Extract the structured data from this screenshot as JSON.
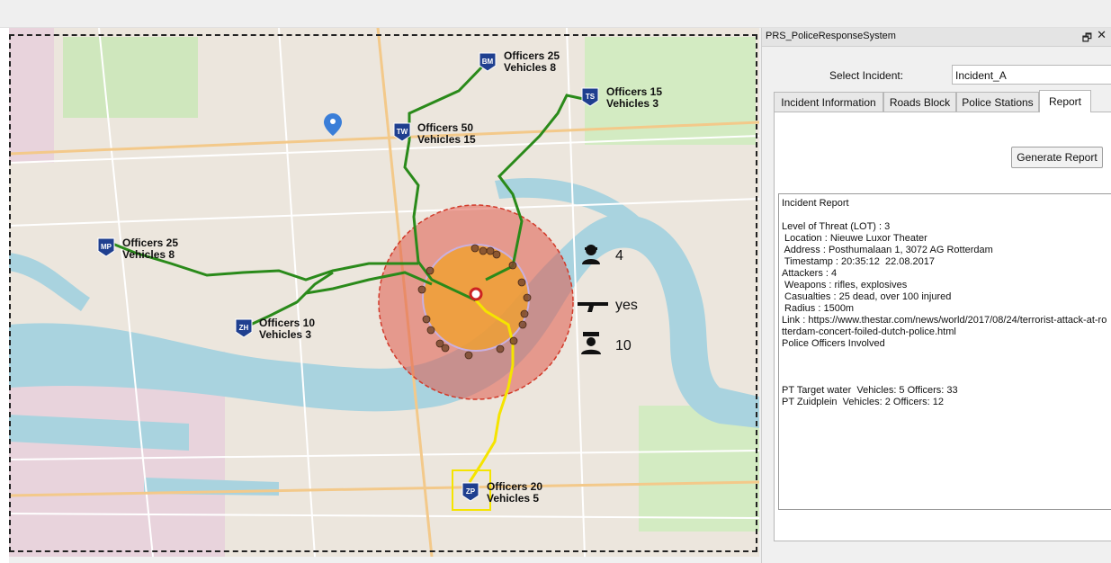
{
  "window": {
    "title": "PRS_PoliceResponseSystem",
    "float_icon": "float-window-icon",
    "close_icon": "close-icon"
  },
  "select": {
    "label": "Select Incident:",
    "value": "Incident_A"
  },
  "tabs": [
    {
      "label": "Incident Information",
      "active": false
    },
    {
      "label": "Roads Block",
      "active": false
    },
    {
      "label": "Police Stations",
      "active": false
    },
    {
      "label": "Report",
      "active": true
    }
  ],
  "generate_button": "Generate Report",
  "report": {
    "heading": "Incident Report",
    "lines": [
      "Level of Threat (LOT) : 3",
      " Location : Nieuwe Luxor Theater",
      " Address : Posthumalaan 1, 3072 AG Rotterdam",
      " Timestamp : 20:35:12  22.08.2017",
      "Attackers : 4",
      " Weapons : rifles, explosives",
      " Casualties : 25 dead, over 100 injured",
      " Radius : 1500m"
    ],
    "link": " Link : https://www.thestar.com/news/world/2017/08/24/terrorist-attack-at-rotterdam-concert-foiled-dutch-police.html",
    "officers_heading": "Police Officers Involved",
    "assignments": [
      "PT Target water  Vehicles: 5 Officers: 33",
      "PT Zuidplein  Vehicles: 2 Officers: 12"
    ]
  },
  "map": {
    "stations": [
      {
        "code": "BM",
        "officers": "Officers  25",
        "vehicles": "Vehicles  8"
      },
      {
        "code": "TS",
        "officers": "Officers  15",
        "vehicles": "Vehicles  3"
      },
      {
        "code": "TW",
        "officers": "Officers  50",
        "vehicles": "Vehicles  15"
      },
      {
        "code": "MP",
        "officers": "Officers 25",
        "vehicles": "Vehicles  8"
      },
      {
        "code": "ZH",
        "officers": "Officers  10",
        "vehicles": "Vehicles  3"
      },
      {
        "code": "ZP",
        "officers": "Officers  20",
        "vehicles": "Vehicles  5"
      }
    ],
    "indicators": {
      "attackers": "4",
      "weapons": "yes",
      "officers_needed": "10"
    },
    "colors": {
      "route_green": "#2a8a1a",
      "route_yellow": "#f5e400",
      "outer_zone": "#e05a4a",
      "inner_zone": "#f0a030",
      "station_badge": "#1f3f8f",
      "selection_box": "#f5e400",
      "incident_marker": "#cc2222",
      "river": "#a9d3df",
      "park": "#c8e6b0",
      "industrial": "#e9d3dc"
    }
  }
}
